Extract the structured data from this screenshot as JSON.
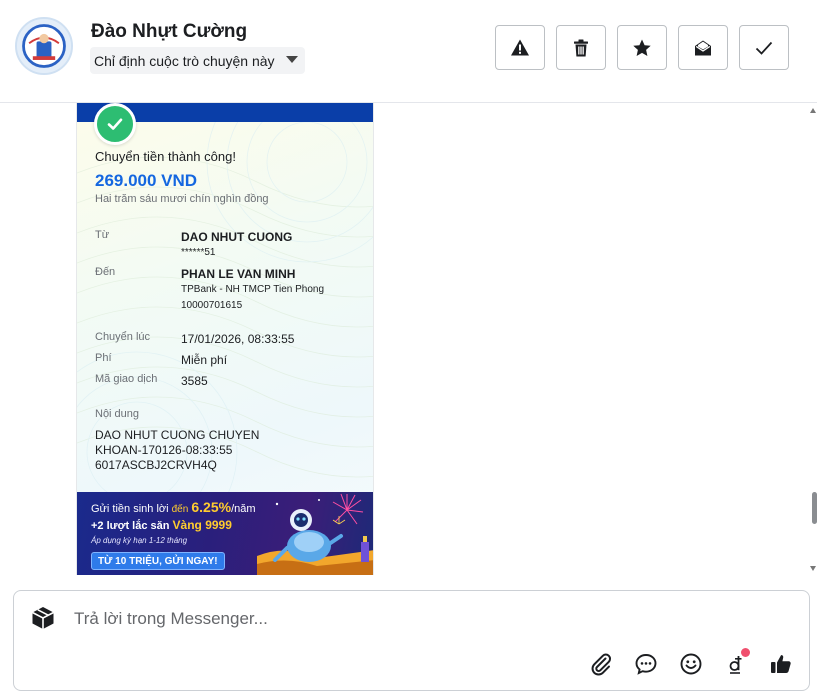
{
  "header": {
    "contact_name": "Đào Nhựt Cường",
    "assign_label": "Chỉ định cuộc trò chuyện này",
    "actions": [
      {
        "name": "report-button",
        "icon": "warning-icon"
      },
      {
        "name": "delete-button",
        "icon": "trash-icon"
      },
      {
        "name": "star-button",
        "icon": "star-icon"
      },
      {
        "name": "mark-unread-button",
        "icon": "open-envelope-icon"
      },
      {
        "name": "mark-done-button",
        "icon": "check-icon"
      }
    ]
  },
  "receipt": {
    "title": "Chuyển tiền thành công!",
    "amount": "269.000 VND",
    "amount_words": "Hai trăm sáu mươi chín nghìn đồng",
    "from_label": "Từ",
    "from_name": "DAO NHUT CUONG",
    "from_account": "******51",
    "to_label": "Đến",
    "to_name": "PHAN LE VAN MINH",
    "to_bank": "TPBank - NH TMCP Tien Phong",
    "to_account": "10000701615",
    "time_label": "Chuyển lúc",
    "time_value": "17/01/2026, 08:33:55",
    "fee_label": "Phí",
    "fee_value": "Miễn phí",
    "txn_label": "Mã giao dịch",
    "txn_value": "3585",
    "content_label": "Nội dung",
    "content_line1": "DAO NHUT CUONG CHUYEN",
    "content_line2": "KHOAN-170126-08:33:55",
    "content_line3": "6017ASCBJ2CRVH4Q"
  },
  "banner": {
    "line1_prefix": "Gửi tiền sinh lời",
    "line1_den": "đến",
    "line1_rate": "6.25%",
    "line1_unit": "/năm",
    "line2_prefix": "+2 lượt lắc săn",
    "line2_highlight": "Vàng 9999",
    "line3": "Áp dụng kỳ hạn 1-12 tháng",
    "cta": "TỪ 10 TRIỆU, GỬI NGAY!"
  },
  "composer": {
    "placeholder": "Trả lời trong Messenger...",
    "actions": [
      "paperclip-icon",
      "chat-bubble-icon",
      "emoji-icon",
      "dong-currency-icon",
      "thumbs-up-icon"
    ]
  },
  "colors": {
    "accent_blue": "#1467e0",
    "success_green": "#2dbd72",
    "banner_navy": "#1a2a8c",
    "banner_gold": "#ffcc2e",
    "notification_red": "#f0506e"
  }
}
